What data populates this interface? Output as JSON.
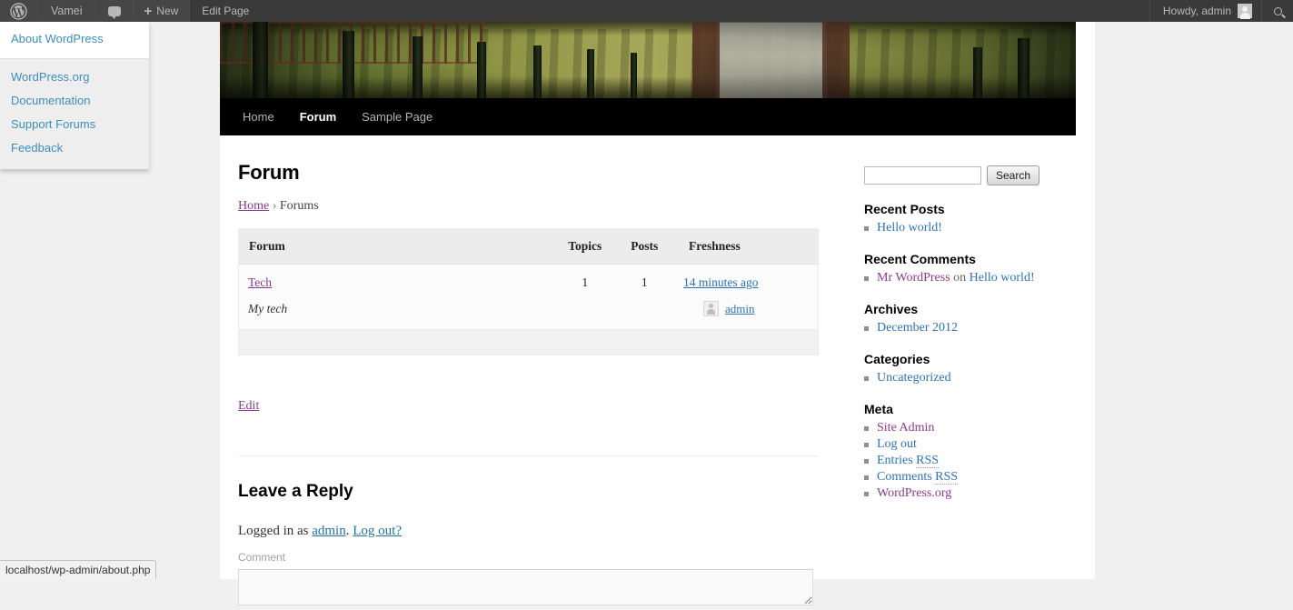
{
  "adminbar": {
    "logo_icon": "wordpress-logo-icon",
    "site_name": "Vamei",
    "comments_icon": "comment-bubble-icon",
    "new_label": "New",
    "new_icon": "plus-icon",
    "edit_page_label": "Edit Page",
    "howdy_label": "Howdy, admin",
    "avatar_icon": "user-avatar-icon",
    "search_icon": "search-icon"
  },
  "dropdown": {
    "primary": [
      {
        "label": "About WordPress"
      }
    ],
    "secondary": [
      {
        "label": "WordPress.org"
      },
      {
        "label": "Documentation"
      },
      {
        "label": "Support Forums"
      },
      {
        "label": "Feedback"
      }
    ]
  },
  "nav": {
    "items": [
      {
        "label": "Home",
        "active": false
      },
      {
        "label": "Forum",
        "active": true
      },
      {
        "label": "Sample Page",
        "active": false
      }
    ]
  },
  "main": {
    "title": "Forum",
    "breadcrumb": {
      "home": "Home",
      "separator": "›",
      "current": "Forums"
    },
    "table": {
      "headers": {
        "forum": "Forum",
        "topics": "Topics",
        "posts": "Posts",
        "freshness": "Freshness"
      },
      "rows": [
        {
          "forum": "Tech",
          "description": "My tech",
          "topics": "1",
          "posts": "1",
          "freshness": "14 minutes ago",
          "author": "admin",
          "author_avatar_icon": "user-avatar-icon"
        }
      ]
    },
    "edit_label": "Edit",
    "reply_title": "Leave a Reply",
    "logged_in_prefix": "Logged in as",
    "logged_in_user": "admin",
    "logged_in_mid": ".",
    "logout_label": "Log out?",
    "comment_label": "Comment",
    "comment_value": ""
  },
  "sidebar": {
    "search": {
      "value": "",
      "button_label": "Search"
    },
    "widgets": [
      {
        "title": "Recent Posts",
        "items": [
          {
            "text": "Hello world!",
            "visited": false
          }
        ]
      },
      {
        "title": "Recent Comments",
        "items": [
          {
            "author": "Mr WordPress",
            "on": "on",
            "post": "Hello world!",
            "type": "comment"
          }
        ]
      },
      {
        "title": "Archives",
        "items": [
          {
            "text": "December 2012",
            "visited": false
          }
        ]
      },
      {
        "title": "Categories",
        "items": [
          {
            "text": "Uncategorized",
            "visited": false
          }
        ]
      },
      {
        "title": "Meta",
        "items": [
          {
            "text": "Site Admin",
            "visited": true
          },
          {
            "text": "Log out",
            "visited": false
          },
          {
            "text": "Entries RSS",
            "visited": false,
            "abbr": "RSS"
          },
          {
            "text": "Comments RSS",
            "visited": false,
            "abbr": "RSS"
          },
          {
            "text": "WordPress.org",
            "visited": true
          }
        ]
      }
    ]
  },
  "statusbar": {
    "url": "localhost/wp-admin/about.php"
  },
  "colors": {
    "adminbar_bg": "#3a3a3a",
    "adminbar_item_bg": "#464646",
    "link_blue": "#2e72b8",
    "link_visited": "#8b3a8b",
    "page_bg": "#f0f0f0",
    "nav_bg": "#000000"
  }
}
